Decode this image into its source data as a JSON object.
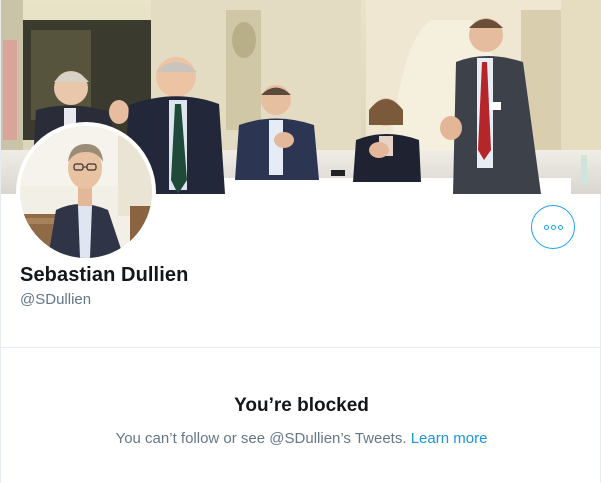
{
  "profile": {
    "display_name": "Sebastian Dullien",
    "handle": "@SDullien"
  },
  "more_button": {
    "icon": "more-horizontal-icon"
  },
  "blocked": {
    "title": "You’re blocked",
    "message": "You can’t follow or see @SDullien’s Tweets.",
    "link_label": "Learn more"
  },
  "colors": {
    "accent": "#1da1f2",
    "link": "#1b95e0",
    "primary_text": "#14171a",
    "secondary_text": "#657786",
    "border": "#e6ecf0"
  }
}
